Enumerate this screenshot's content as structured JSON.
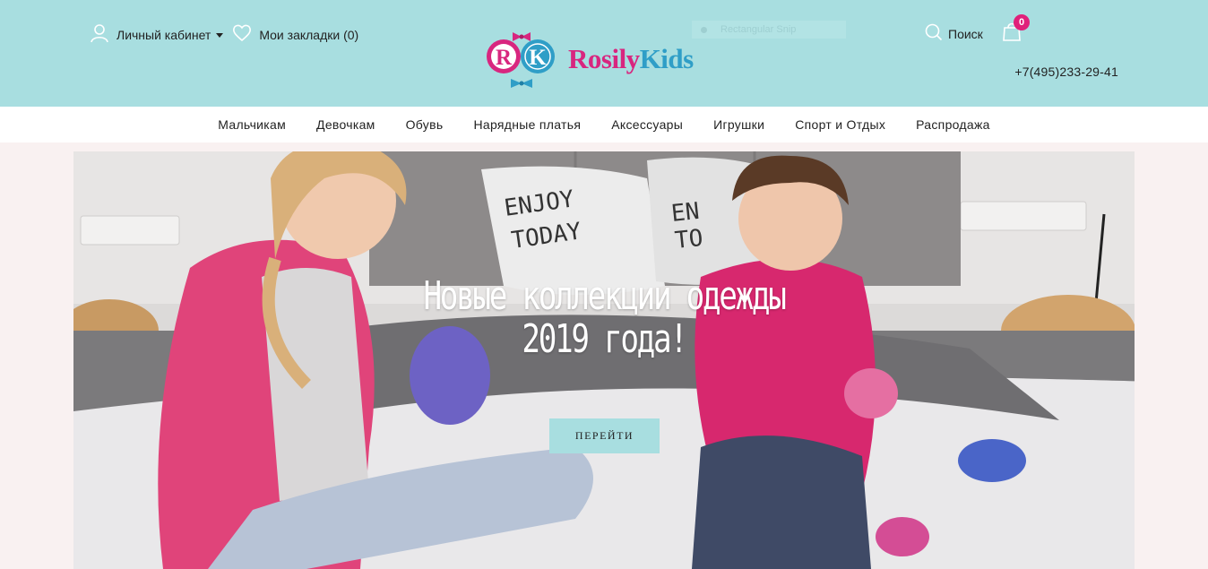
{
  "header": {
    "account_label": "Личный кабинет",
    "bookmarks_label": "Мои закладки (0)",
    "snip_label": "Rectangular Snip",
    "logo": {
      "monogram_left": "R",
      "monogram_right": "K",
      "word_left": "Rosily",
      "word_right": "Kids"
    },
    "search_label": "Поиск",
    "cart_count": "0",
    "phone": "+7(495)233-29-41"
  },
  "nav": {
    "items": [
      "Мальчикам",
      "Девочкам",
      "Обувь",
      "Нарядные платья",
      "Аксессуары",
      "Игрушки",
      "Спорт и Отдых",
      "Распродажа"
    ]
  },
  "hero": {
    "title_line1": "Новые коллекции одежды",
    "title_line2": "2019 года!",
    "button_label": "ПЕРЕЙТИ",
    "pillow_left": [
      "ENJOY",
      "TODAY"
    ],
    "pillow_right": [
      "EN",
      "TO"
    ]
  },
  "colors": {
    "header_bg": "#a8dee0",
    "brand_pink": "#d8267f",
    "brand_blue": "#2f9ec7",
    "badge": "#e0207a"
  }
}
